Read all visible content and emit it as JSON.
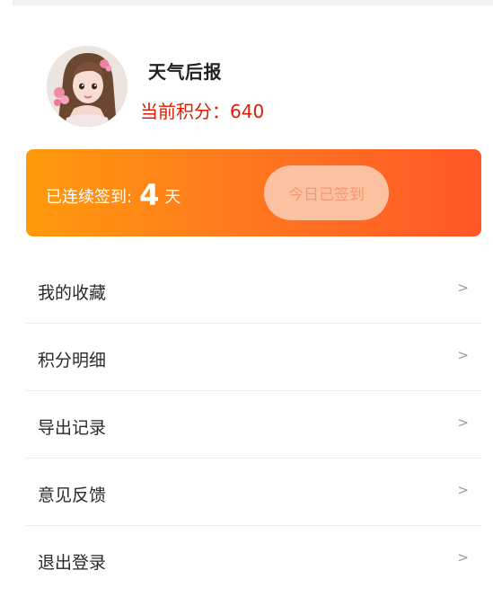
{
  "profile": {
    "name": "天气后报",
    "points_text": "当前积分：640"
  },
  "checkin": {
    "streak_prefix": "已连续签到:",
    "streak_days": "4",
    "streak_suffix": "天",
    "button_label": "今日已签到"
  },
  "menu": {
    "items": [
      {
        "label": "我的收藏",
        "arrow": ">"
      },
      {
        "label": "积分明细",
        "arrow": ">"
      },
      {
        "label": "导出记录",
        "arrow": ">"
      },
      {
        "label": "意见反馈",
        "arrow": ">"
      },
      {
        "label": "退出登录",
        "arrow": ">"
      }
    ]
  },
  "colors": {
    "points": "#d81e06",
    "card_gradient_start": "#ff9a0b",
    "card_gradient_end": "#ff5726"
  },
  "icons": {
    "avatar": "avatar-portrait"
  }
}
